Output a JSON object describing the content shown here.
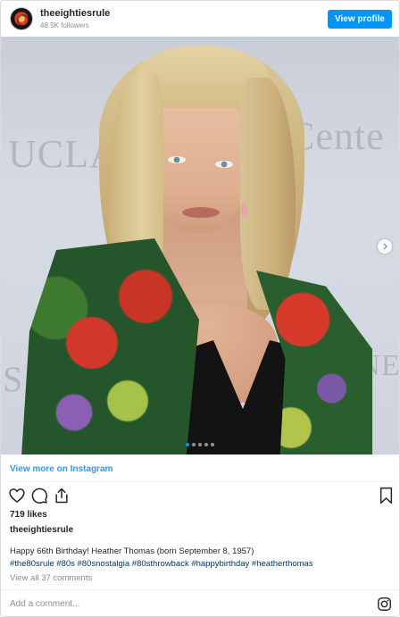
{
  "header": {
    "username": "theeightiesrule",
    "followers": "48.5K followers",
    "view_profile_label": "View profile"
  },
  "photo": {
    "backdrop_words": [
      "UCLA",
      "Cente",
      "S",
      "INE"
    ],
    "carousel_dots": 5,
    "active_dot": 1
  },
  "icons": {
    "avatar": "profile-avatar",
    "like": "heart-icon",
    "comment": "comment-icon",
    "share": "share-icon",
    "save": "bookmark-icon",
    "next": "chevron-right-icon",
    "brand": "instagram-icon"
  },
  "view_more_label": "View more on Instagram",
  "likes": "719 likes",
  "caption": {
    "username": "theeightiesrule",
    "text": "Happy 66th Birthday! Heather Thomas (born September 8, 1957)",
    "hashtags": "#the80srule #80s #80snostalgia #80sthrowback #happybirthday #heatherthomas"
  },
  "view_comments_label": "View all 37 comments",
  "comment_placeholder": "Add a comment...",
  "colors": {
    "accent": "#0095f6",
    "link": "#3897f0",
    "hashtag": "#00376b",
    "muted": "#8e8e8e"
  }
}
